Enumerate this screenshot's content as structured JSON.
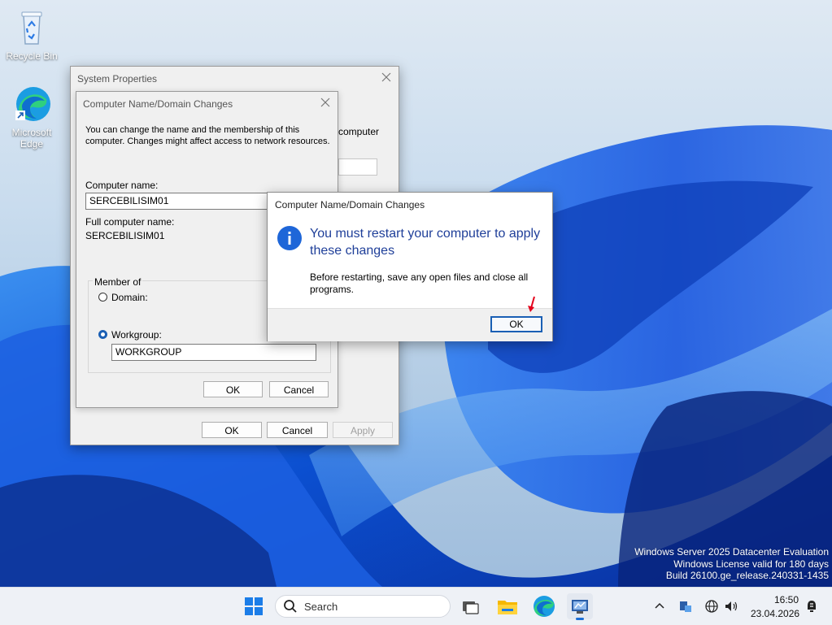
{
  "desktop": {
    "icons": [
      {
        "label": "Recycle Bin",
        "icon": "recycle-bin-icon"
      },
      {
        "label": "Microsoft\nEdge",
        "label_line1": "Microsoft",
        "label_line2": "Edge",
        "icon": "edge-icon"
      }
    ],
    "watermark": {
      "line1": "Windows Server 2025 Datacenter Evaluation",
      "line2": "Windows License valid for 180 days",
      "line3": "Build 26100.ge_release.240331-1435"
    }
  },
  "system_properties": {
    "title": "System Properties",
    "partial_text": "computer",
    "ok_label": "OK",
    "cancel_label": "Cancel",
    "apply_label": "Apply"
  },
  "name_changes": {
    "title": "Computer Name/Domain Changes",
    "description_line1": "You can change the name and the membership of this",
    "description_line2": "computer. Changes might affect access to network resources.",
    "computer_name_label": "Computer name:",
    "computer_name_value": "SERCEBILISIM01",
    "full_name_label": "Full computer name:",
    "full_name_value": "SERCEBILISIM01",
    "member_of_label": "Member of",
    "domain_label": "Domain:",
    "workgroup_label": "Workgroup:",
    "workgroup_value": "WORKGROUP",
    "selected": "workgroup",
    "ok_label": "OK",
    "cancel_label": "Cancel"
  },
  "restart_dialog": {
    "title": "Computer Name/Domain Changes",
    "heading_line1": "You must restart your computer to apply",
    "heading_line2": "these changes",
    "body_line1": "Before restarting, save any open files and close all",
    "body_line2": "programs.",
    "ok_label": "OK",
    "icon": "info-icon"
  },
  "taskbar": {
    "search_placeholder": "Search",
    "time": "16:50",
    "date": "23.04.2026",
    "pinned": [
      "start-icon",
      "task-view-icon",
      "file-explorer-icon",
      "edge-icon",
      "server-manager-icon"
    ]
  },
  "colors": {
    "accent": "#1a5fb4",
    "heading_blue": "#1f3f99",
    "taskbar_bg": "#eef1f6"
  }
}
